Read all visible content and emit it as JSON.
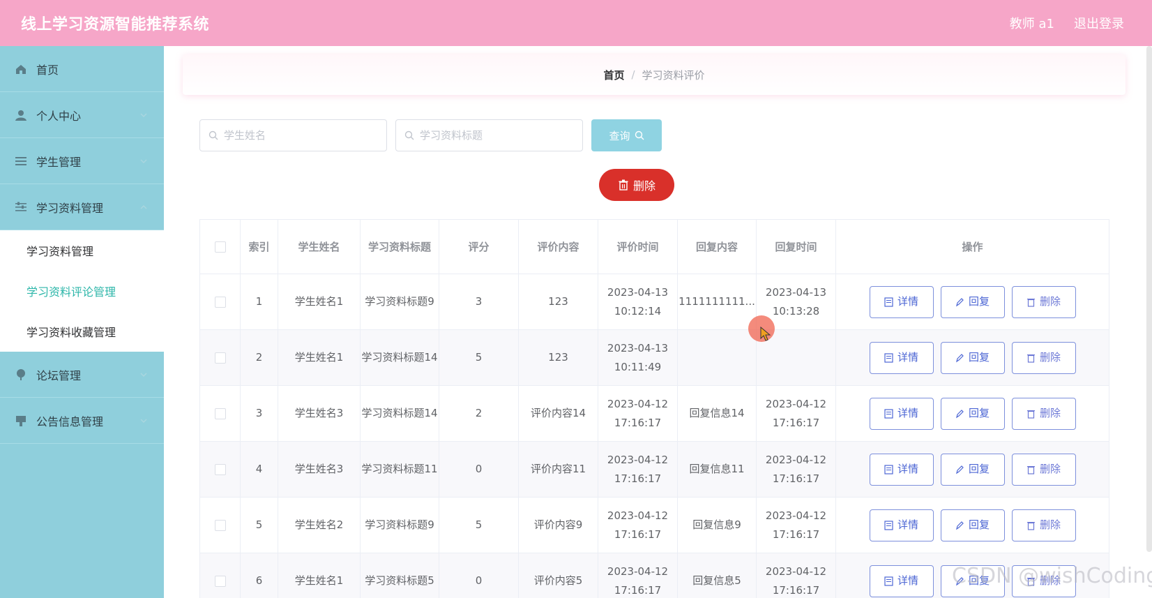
{
  "header": {
    "title": "线上学习资源智能推荐系统",
    "user": "教师 a1",
    "logout": "退出登录"
  },
  "sidebar": {
    "home": "首页",
    "personal": "个人中心",
    "student_mgmt": "学生管理",
    "material_mgmt": "学习资料管理",
    "sub_items": [
      "学习资料管理",
      "学习资料评论管理",
      "学习资料收藏管理"
    ],
    "forum_mgmt": "论坛管理",
    "notice_mgmt": "公告信息管理"
  },
  "breadcrumb": {
    "home": "首页",
    "sep": "/",
    "current": "学习资料评价"
  },
  "search": {
    "student_placeholder": "学生姓名",
    "title_placeholder": "学习资料标题",
    "query_label": "查询"
  },
  "delete_label": "删除",
  "table": {
    "headers": [
      "索引",
      "学生姓名",
      "学习资料标题",
      "评分",
      "评价内容",
      "评价时间",
      "回复内容",
      "回复时间",
      "操作"
    ],
    "rows": [
      {
        "index": "1",
        "name": "学生姓名1",
        "title": "学习资料标题9",
        "score": "3",
        "content": "123",
        "eval_time": "2023-04-13 10:12:14",
        "reply": "1111111111...",
        "reply_time": "2023-04-13 10:13:28"
      },
      {
        "index": "2",
        "name": "学生姓名1",
        "title": "学习资料标题14",
        "score": "5",
        "content": "123",
        "eval_time": "2023-04-13 10:11:49",
        "reply": "",
        "reply_time": ""
      },
      {
        "index": "3",
        "name": "学生姓名3",
        "title": "学习资料标题14",
        "score": "2",
        "content": "评价内容14",
        "eval_time": "2023-04-12 17:16:17",
        "reply": "回复信息14",
        "reply_time": "2023-04-12 17:16:17"
      },
      {
        "index": "4",
        "name": "学生姓名3",
        "title": "学习资料标题11",
        "score": "0",
        "content": "评价内容11",
        "eval_time": "2023-04-12 17:16:17",
        "reply": "回复信息11",
        "reply_time": "2023-04-12 17:16:17"
      },
      {
        "index": "5",
        "name": "学生姓名2",
        "title": "学习资料标题9",
        "score": "5",
        "content": "评价内容9",
        "eval_time": "2023-04-12 17:16:17",
        "reply": "回复信息9",
        "reply_time": "2023-04-12 17:16:17"
      },
      {
        "index": "6",
        "name": "学生姓名1",
        "title": "学习资料标题5",
        "score": "0",
        "content": "评价内容5",
        "eval_time": "2023-04-12 17:16:17",
        "reply": "回复信息5",
        "reply_time": "2023-04-12 17:16:17"
      }
    ],
    "ops": {
      "detail": "详情",
      "reply": "回复",
      "delete": "删除"
    }
  },
  "watermark": "CSDN @wishCoding",
  "colors": {
    "header": "#f6a6c8",
    "sidebar": "#8fcfdc",
    "active": "#2cb6a9",
    "danger": "#d9302a",
    "query": "#8fd3e2",
    "op_border": "#7c8fdc"
  }
}
